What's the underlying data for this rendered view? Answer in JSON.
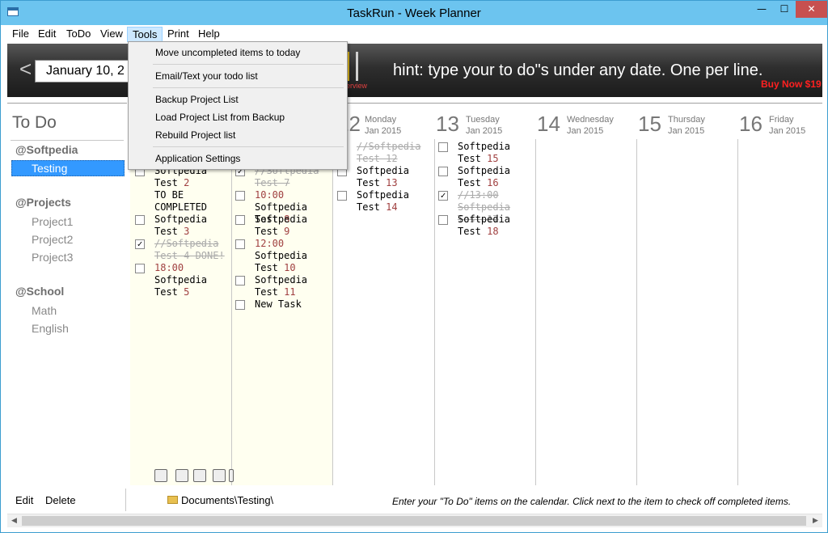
{
  "window": {
    "title": "TaskRun - Week Planner"
  },
  "menubar": [
    "File",
    "Edit",
    "ToDo",
    "View",
    "Tools",
    "Print",
    "Help"
  ],
  "banner": {
    "date_value": "January   10, 2",
    "back_arrow": "<",
    "overview": "erview",
    "hint": "hint: type your to do\"s under any date. One per line.",
    "buy_now": "Buy Now $19"
  },
  "sidebar": {
    "title": "To Do",
    "groups": [
      {
        "name": "@Softpedia",
        "items": [
          "Testing"
        ]
      },
      {
        "name": "@Projects",
        "items": [
          "Project1",
          "Project2",
          "Project3"
        ]
      },
      {
        "name": "@School",
        "items": [
          "Math",
          "English"
        ]
      }
    ]
  },
  "days": [
    {
      "num": "12",
      "name": "Monday",
      "month": "Jan 2015"
    },
    {
      "num": "13",
      "name": "Tuesday",
      "month": "Jan 2015"
    },
    {
      "num": "14",
      "name": "Wednesday",
      "month": "Jan 2015"
    },
    {
      "num": "15",
      "name": "Thursday",
      "month": "Jan 2015"
    },
    {
      "num": "16",
      "name": "Friday",
      "month": "Jan 2015"
    }
  ],
  "tasks": {
    "col1": [
      {
        "text": "Softpedia Test",
        "num": "2",
        "done": false
      },
      {
        "text": "TO BE COMPLETED",
        "num": "",
        "done": false,
        "nocb": true
      },
      {
        "text": "Softpedia Test",
        "num": "3",
        "done": false
      },
      {
        "text": "//Softpedia Test 4 DONE!",
        "num": "",
        "done": true
      },
      {
        "time": "18:00",
        "text": "Softpedia Test",
        "num": "5",
        "done": false
      }
    ],
    "col2": [
      {
        "text": "//Softpedia Test 7",
        "num": "",
        "done": true
      },
      {
        "time": "10:00",
        "text": "Softpedia Test",
        "num": "8",
        "done": false
      },
      {
        "text": "Softpedia Test",
        "num": "9",
        "done": false
      },
      {
        "time": "12:00",
        "text": "Softpedia Test",
        "num": "10",
        "done": false
      },
      {
        "text": "Softpedia Test",
        "num": "11",
        "done": false
      },
      {
        "text": "New Task",
        "num": "",
        "done": false
      }
    ],
    "col3": [
      {
        "text": "//Softpedia Test 12",
        "num": "",
        "done": true
      },
      {
        "text": "Softpedia Test",
        "num": "13",
        "done": false
      },
      {
        "text": "Softpedia Test",
        "num": "14",
        "done": false
      }
    ],
    "col4": [
      {
        "text": "Softpedia Test",
        "num": "15",
        "done": false
      },
      {
        "text": "Softpedia Test",
        "num": "16",
        "done": false
      },
      {
        "text": "//13:00 Softpedia Test 17",
        "num": "",
        "done": true
      },
      {
        "text": "Softpedia Test",
        "num": "18",
        "done": false
      }
    ]
  },
  "dropdown": [
    "Move uncompleted items to today",
    "Email/Text your todo list",
    "Backup Project List",
    "Load Project List from Backup",
    "Rebuild Project list",
    "Application Settings"
  ],
  "bottom": {
    "edit": "Edit",
    "delete": "Delete",
    "folder": "Documents\\Testing\\",
    "hint": "Enter your \"To Do\" items on the calendar. Click next to the item to check off completed items."
  }
}
